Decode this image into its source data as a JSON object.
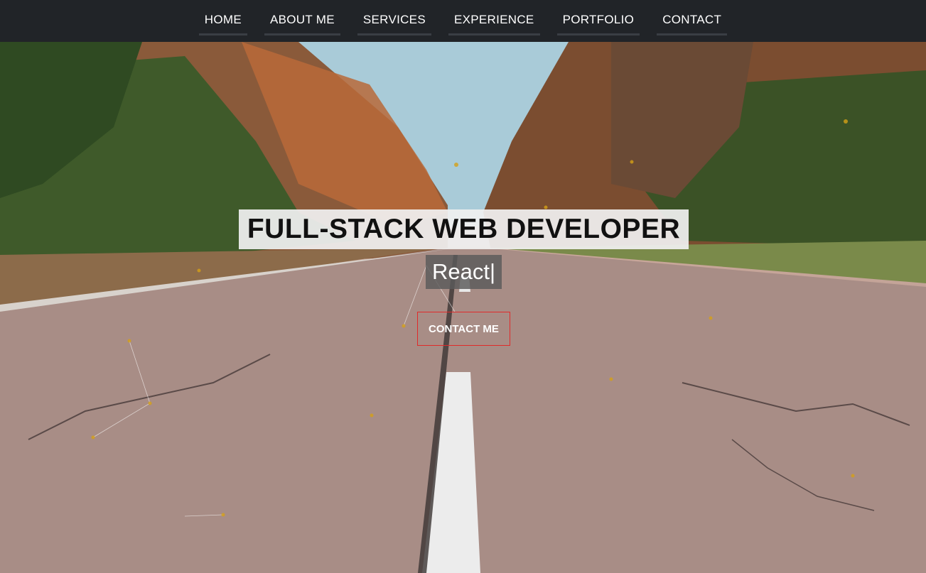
{
  "nav": {
    "items": [
      {
        "label": "HOME"
      },
      {
        "label": "ABOUT ME"
      },
      {
        "label": "SERVICES"
      },
      {
        "label": "EXPERIENCE"
      },
      {
        "label": "PORTFOLIO"
      },
      {
        "label": "CONTACT"
      }
    ]
  },
  "hero": {
    "headline": "FULL-STACK WEB DEVELOPER",
    "typed_text": "React",
    "cursor": "|",
    "cta_label": "CONTACT ME"
  },
  "colors": {
    "navbar": "#212428",
    "cta_border": "#e02a2a",
    "particle": "#d4a017"
  }
}
